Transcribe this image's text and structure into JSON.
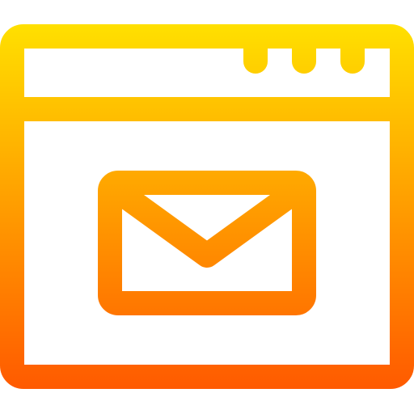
{
  "icon": {
    "name": "browser-window-mail-icon",
    "gradient": {
      "top_color": "#FFE000",
      "bottom_color": "#FF5A00"
    },
    "window_controls": [
      "control-dot",
      "control-dot",
      "control-dot"
    ],
    "content_icon": "envelope-icon"
  }
}
